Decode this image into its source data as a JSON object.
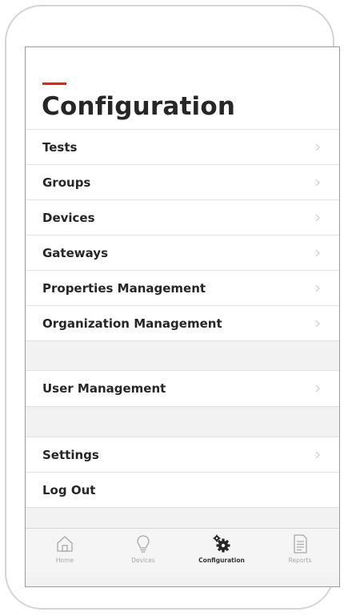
{
  "page": {
    "title": "Configuration",
    "accent_color": "#e2231a"
  },
  "menu": {
    "items": [
      {
        "label": "Tests"
      },
      {
        "label": "Groups"
      },
      {
        "label": "Devices"
      },
      {
        "label": "Gateways"
      },
      {
        "label": "Properties Management"
      },
      {
        "label": "Organization Management"
      },
      {
        "label": "User Management"
      },
      {
        "label": "Settings"
      },
      {
        "label": "Log Out"
      }
    ]
  },
  "tabbar": {
    "active": "Configuration",
    "tabs": [
      {
        "label": "Home",
        "icon": "home-icon"
      },
      {
        "label": "Devices",
        "icon": "lightbulb-icon"
      },
      {
        "label": "Configuration",
        "icon": "gears-icon"
      },
      {
        "label": "Reports",
        "icon": "document-icon"
      }
    ]
  }
}
